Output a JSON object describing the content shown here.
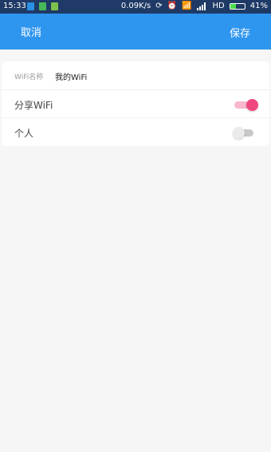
{
  "status_bar": {
    "time": "15:33",
    "network_speed": "0.09K/s",
    "network_type": "HD",
    "battery_percent": "41%",
    "battery_level": 0.41,
    "notification_icons": [
      "bluetooth-icon",
      "wechat-icon",
      "app-icon"
    ],
    "colors": {
      "bg": "#1f3a66",
      "battery_fill": "#4cdc4c"
    }
  },
  "header": {
    "cancel_label": "取消",
    "save_label": "保存",
    "bg_color": "#2f96ef"
  },
  "form": {
    "wifi_name_label": "WiFi名称",
    "wifi_name_value": "我的WiFi",
    "share_wifi_label": "分享WiFi",
    "share_wifi_on": true,
    "personal_label": "个人",
    "personal_on": false,
    "toggle_on_color": "#f0477f"
  }
}
